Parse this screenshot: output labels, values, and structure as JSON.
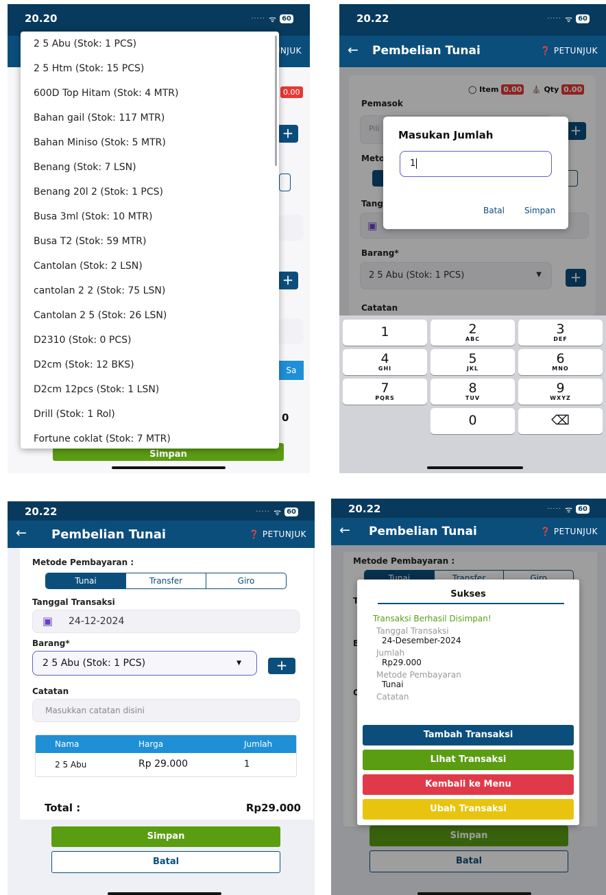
{
  "status": {
    "signal": "·····",
    "wifi": "ᯤ",
    "battery": "60"
  },
  "common": {
    "back_icon": "←",
    "app_title": "Pembelian Tunai",
    "help_label": "PETUNJUK",
    "tunai": "Tunai",
    "transfer": "Transfer",
    "giro": "Giro",
    "metode_label": "Metode Pembayaran :",
    "tanggal_label": "Tanggal Transaksi",
    "barang_label": "Barang*",
    "catatan_label": "Catatan",
    "catatan_placeholder": "Masukkan catatan disini",
    "barang_value": "2 5 Abu (Stok: 1 PCS)",
    "simpan": "Simpan",
    "batal": "Batal"
  },
  "s1": {
    "time": "20.20",
    "help_partial": "UNJUK",
    "badge_partial": "0.00",
    "side_button_partial": "Sa",
    "total_partial": "0",
    "dropdown_items": [
      "2 5 Abu (Stok: 1 PCS)",
      "2 5 Htm (Stok: 15 PCS)",
      "600D Top Hitam (Stok: 4 MTR)",
      "Bahan gail (Stok: 117 MTR)",
      "Bahan Miniso (Stok: 5 MTR)",
      "Benang (Stok: 7 LSN)",
      "Benang 20l 2 (Stok: 1 PCS)",
      "Busa 3ml (Stok: 10 MTR)",
      "Busa T2 (Stok: 59 MTR)",
      "Cantolan (Stok: 2 LSN)",
      "cantolan 2 2 (Stok: 75 LSN)",
      "Cantolan 2 5 (Stok: 26 LSN)",
      "D2310 (Stok: 0 PCS)",
      "D2cm (Stok: 12 BKS)",
      "D2cm 12pcs (Stok: 1 LSN)",
      "Drill (Stok: 1 Rol)",
      "Fortune coklat (Stok: 7 MTR)"
    ]
  },
  "s2": {
    "time": "20.22",
    "item_label": "Item",
    "qty_label": "Qty",
    "badge_value": "0.00",
    "pemasok_label": "Pemasok",
    "pemasok_partial": "Pili",
    "metode_partial": "Meto",
    "tanggal_partial": "Tang",
    "dialog_title": "Masukan Jumlah",
    "dialog_value": "1",
    "dialog_cancel": "Batal",
    "dialog_save": "Simpan",
    "keys": [
      {
        "n": "1",
        "l": ""
      },
      {
        "n": "2",
        "l": "ABC"
      },
      {
        "n": "3",
        "l": "DEF"
      },
      {
        "n": "4",
        "l": "GHI"
      },
      {
        "n": "5",
        "l": "JKL"
      },
      {
        "n": "6",
        "l": "MNO"
      },
      {
        "n": "7",
        "l": "PQRS"
      },
      {
        "n": "8",
        "l": "TUV"
      },
      {
        "n": "9",
        "l": "WXYZ"
      },
      {
        "n": "",
        "l": ""
      },
      {
        "n": "0",
        "l": ""
      },
      {
        "n": "⌫",
        "l": ""
      }
    ]
  },
  "s3": {
    "time": "20.22",
    "date": "24-12-2024",
    "table_headers": [
      "Nama",
      "Harga",
      "Jumlah"
    ],
    "table_row": [
      "2 5 Abu",
      "Rp 29.000",
      "1"
    ],
    "total_label": "Total :",
    "total_value": "Rp29.000"
  },
  "s4": {
    "time": "20.22",
    "modal_title": "Sukses",
    "success_msg": "Transaksi Berhasil Disimpan!",
    "tanggal_label": "Tanggal Transaksi",
    "tanggal_value": "24-Desember-2024",
    "jumlah_label": "Jumlah",
    "jumlah_value": "Rp29.000",
    "metode_label": "Metode Pembayaran",
    "metode_value": "Tunai",
    "catatan_label": "Catatan",
    "btn_tambah": "Tambah Transaksi",
    "btn_lihat": "Lihat Transaksi",
    "btn_kembali": "Kembali ke Menu",
    "btn_ubah": "Ubah Transaksi",
    "partial_letters": [
      "T",
      "B",
      "C"
    ]
  },
  "colors": {
    "primary": "#0b4e7c",
    "status": "#073a5c",
    "green": "#5b9d12",
    "red": "#e03a4a",
    "yellow": "#e8c40e",
    "teal": "#1f8fd6",
    "badge": "#e53935"
  }
}
